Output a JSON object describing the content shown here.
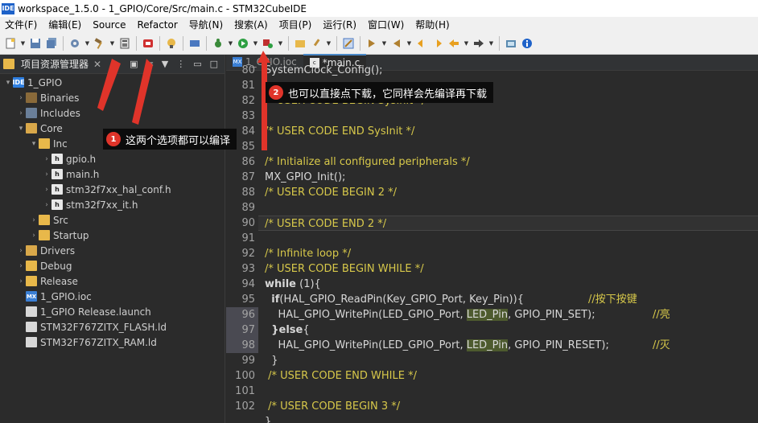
{
  "window": {
    "title": "workspace_1.5.0 - 1_GPIO/Core/Src/main.c - STM32CubeIDE",
    "logo": "IDE"
  },
  "menu": [
    "文件(F)",
    "编辑(E)",
    "Source",
    "Refactor",
    "导航(N)",
    "搜索(A)",
    "项目(P)",
    "运行(R)",
    "窗口(W)",
    "帮助(H)"
  ],
  "explorer": {
    "title": "项目资源管理器",
    "items": [
      {
        "label": "1_GPIO",
        "icon": "proj",
        "glyph": "IDE",
        "twisty": "▾",
        "depth": 0
      },
      {
        "label": "Binaries",
        "icon": "bin",
        "glyph": "",
        "twisty": "›",
        "depth": 1
      },
      {
        "label": "Includes",
        "icon": "inc",
        "glyph": "",
        "twisty": "›",
        "depth": 1
      },
      {
        "label": "Core",
        "icon": "folder-src",
        "glyph": "",
        "twisty": "▾",
        "depth": 1
      },
      {
        "label": "Inc",
        "icon": "folder",
        "glyph": "",
        "twisty": "▾",
        "depth": 2
      },
      {
        "label": "gpio.h",
        "icon": "hfile",
        "glyph": "h",
        "twisty": "›",
        "depth": 3
      },
      {
        "label": "main.h",
        "icon": "hfile",
        "glyph": "h",
        "twisty": "›",
        "depth": 3
      },
      {
        "label": "stm32f7xx_hal_conf.h",
        "icon": "hfile",
        "glyph": "h",
        "twisty": "›",
        "depth": 3
      },
      {
        "label": "stm32f7xx_it.h",
        "icon": "hfile",
        "glyph": "h",
        "twisty": "›",
        "depth": 3
      },
      {
        "label": "Src",
        "icon": "folder",
        "glyph": "",
        "twisty": "›",
        "depth": 2
      },
      {
        "label": "Startup",
        "icon": "folder",
        "glyph": "",
        "twisty": "›",
        "depth": 2
      },
      {
        "label": "Drivers",
        "icon": "folder-src",
        "glyph": "",
        "twisty": "›",
        "depth": 1
      },
      {
        "label": "Debug",
        "icon": "folder",
        "glyph": "",
        "twisty": "›",
        "depth": 1
      },
      {
        "label": "Release",
        "icon": "folder",
        "glyph": "",
        "twisty": "›",
        "depth": 1
      },
      {
        "label": "1_GPIO.ioc",
        "icon": "mx",
        "glyph": "MX",
        "twisty": "",
        "depth": 1
      },
      {
        "label": "1_GPIO Release.launch",
        "icon": "file",
        "glyph": "",
        "twisty": "",
        "depth": 1
      },
      {
        "label": "STM32F767ZITX_FLASH.ld",
        "icon": "file",
        "glyph": "",
        "twisty": "",
        "depth": 1
      },
      {
        "label": "STM32F767ZITX_RAM.ld",
        "icon": "file",
        "glyph": "",
        "twisty": "",
        "depth": 1
      }
    ]
  },
  "editor": {
    "tabs": [
      {
        "label": "1_GPIO.ioc",
        "icon": "MX",
        "active": false
      },
      {
        "label": "*main.c",
        "icon": "c",
        "active": true
      }
    ],
    "lines": [
      {
        "n": "80",
        "t": "SystemClock_Config();",
        "c": "plain"
      },
      {
        "n": "81",
        "t": "",
        "c": "plain"
      },
      {
        "n": "82",
        "t": "/* USER CODE BEGIN SysInit */",
        "c": "cmt"
      },
      {
        "n": "83",
        "t": "",
        "c": "plain"
      },
      {
        "n": "84",
        "t": "/* USER CODE END SysInit */",
        "c": "cmt"
      },
      {
        "n": "85",
        "t": "",
        "c": "plain"
      },
      {
        "n": "86",
        "t": "/* Initialize all configured peripherals */",
        "c": "cmt"
      },
      {
        "n": "87",
        "t": "MX_GPIO_Init();",
        "c": "plain"
      },
      {
        "n": "88",
        "t": "/* USER CODE BEGIN 2 */",
        "c": "cmt"
      },
      {
        "n": "89",
        "t": "",
        "c": "plain"
      },
      {
        "n": "90",
        "t": "/* USER CODE END 2 */",
        "c": "cmt",
        "cur": true
      },
      {
        "n": "91",
        "t": "",
        "c": "plain"
      },
      {
        "n": "92",
        "t": "/* Infinite loop */",
        "c": "cmt"
      },
      {
        "n": "93",
        "t": "/* USER CODE BEGIN WHILE */",
        "c": "cmt"
      },
      {
        "n": "94",
        "t": "while (1){",
        "c": "while"
      },
      {
        "n": "95",
        "t": "  if(HAL_GPIO_ReadPin(Key_GPIO_Port, Key_Pin)){",
        "c": "if",
        "zh": "//按下按键"
      },
      {
        "n": "96",
        "t": "    HAL_GPIO_WritePin(LED_GPIO_Port, LED_Pin, GPIO_PIN_SET);",
        "c": "write",
        "zh": "//亮",
        "mark": true
      },
      {
        "n": "97",
        "t": "  }else{",
        "c": "else",
        "mark": true
      },
      {
        "n": "98",
        "t": "    HAL_GPIO_WritePin(LED_GPIO_Port, LED_Pin, GPIO_PIN_RESET);",
        "c": "write",
        "zh": "//灭",
        "mark": true
      },
      {
        "n": "99",
        "t": "  }",
        "c": "plain"
      },
      {
        "n": "100",
        "t": " /* USER CODE END WHILE */",
        "c": "cmt"
      },
      {
        "n": "101",
        "t": "",
        "c": "plain"
      },
      {
        "n": "102",
        "t": " /* USER CODE BEGIN 3 */",
        "c": "cmt"
      },
      {
        "n": "",
        "t": "}",
        "c": "plain"
      }
    ]
  },
  "annotations": {
    "one": {
      "badge": "1",
      "text": "这两个选项都可以编译"
    },
    "two": {
      "badge": "2",
      "text": "也可以直接点下载，它同样会先编译再下载"
    }
  },
  "colors": {
    "comment": "#d7c84a",
    "callout_badge": "#e0342a",
    "arrow": "#e0342a"
  }
}
